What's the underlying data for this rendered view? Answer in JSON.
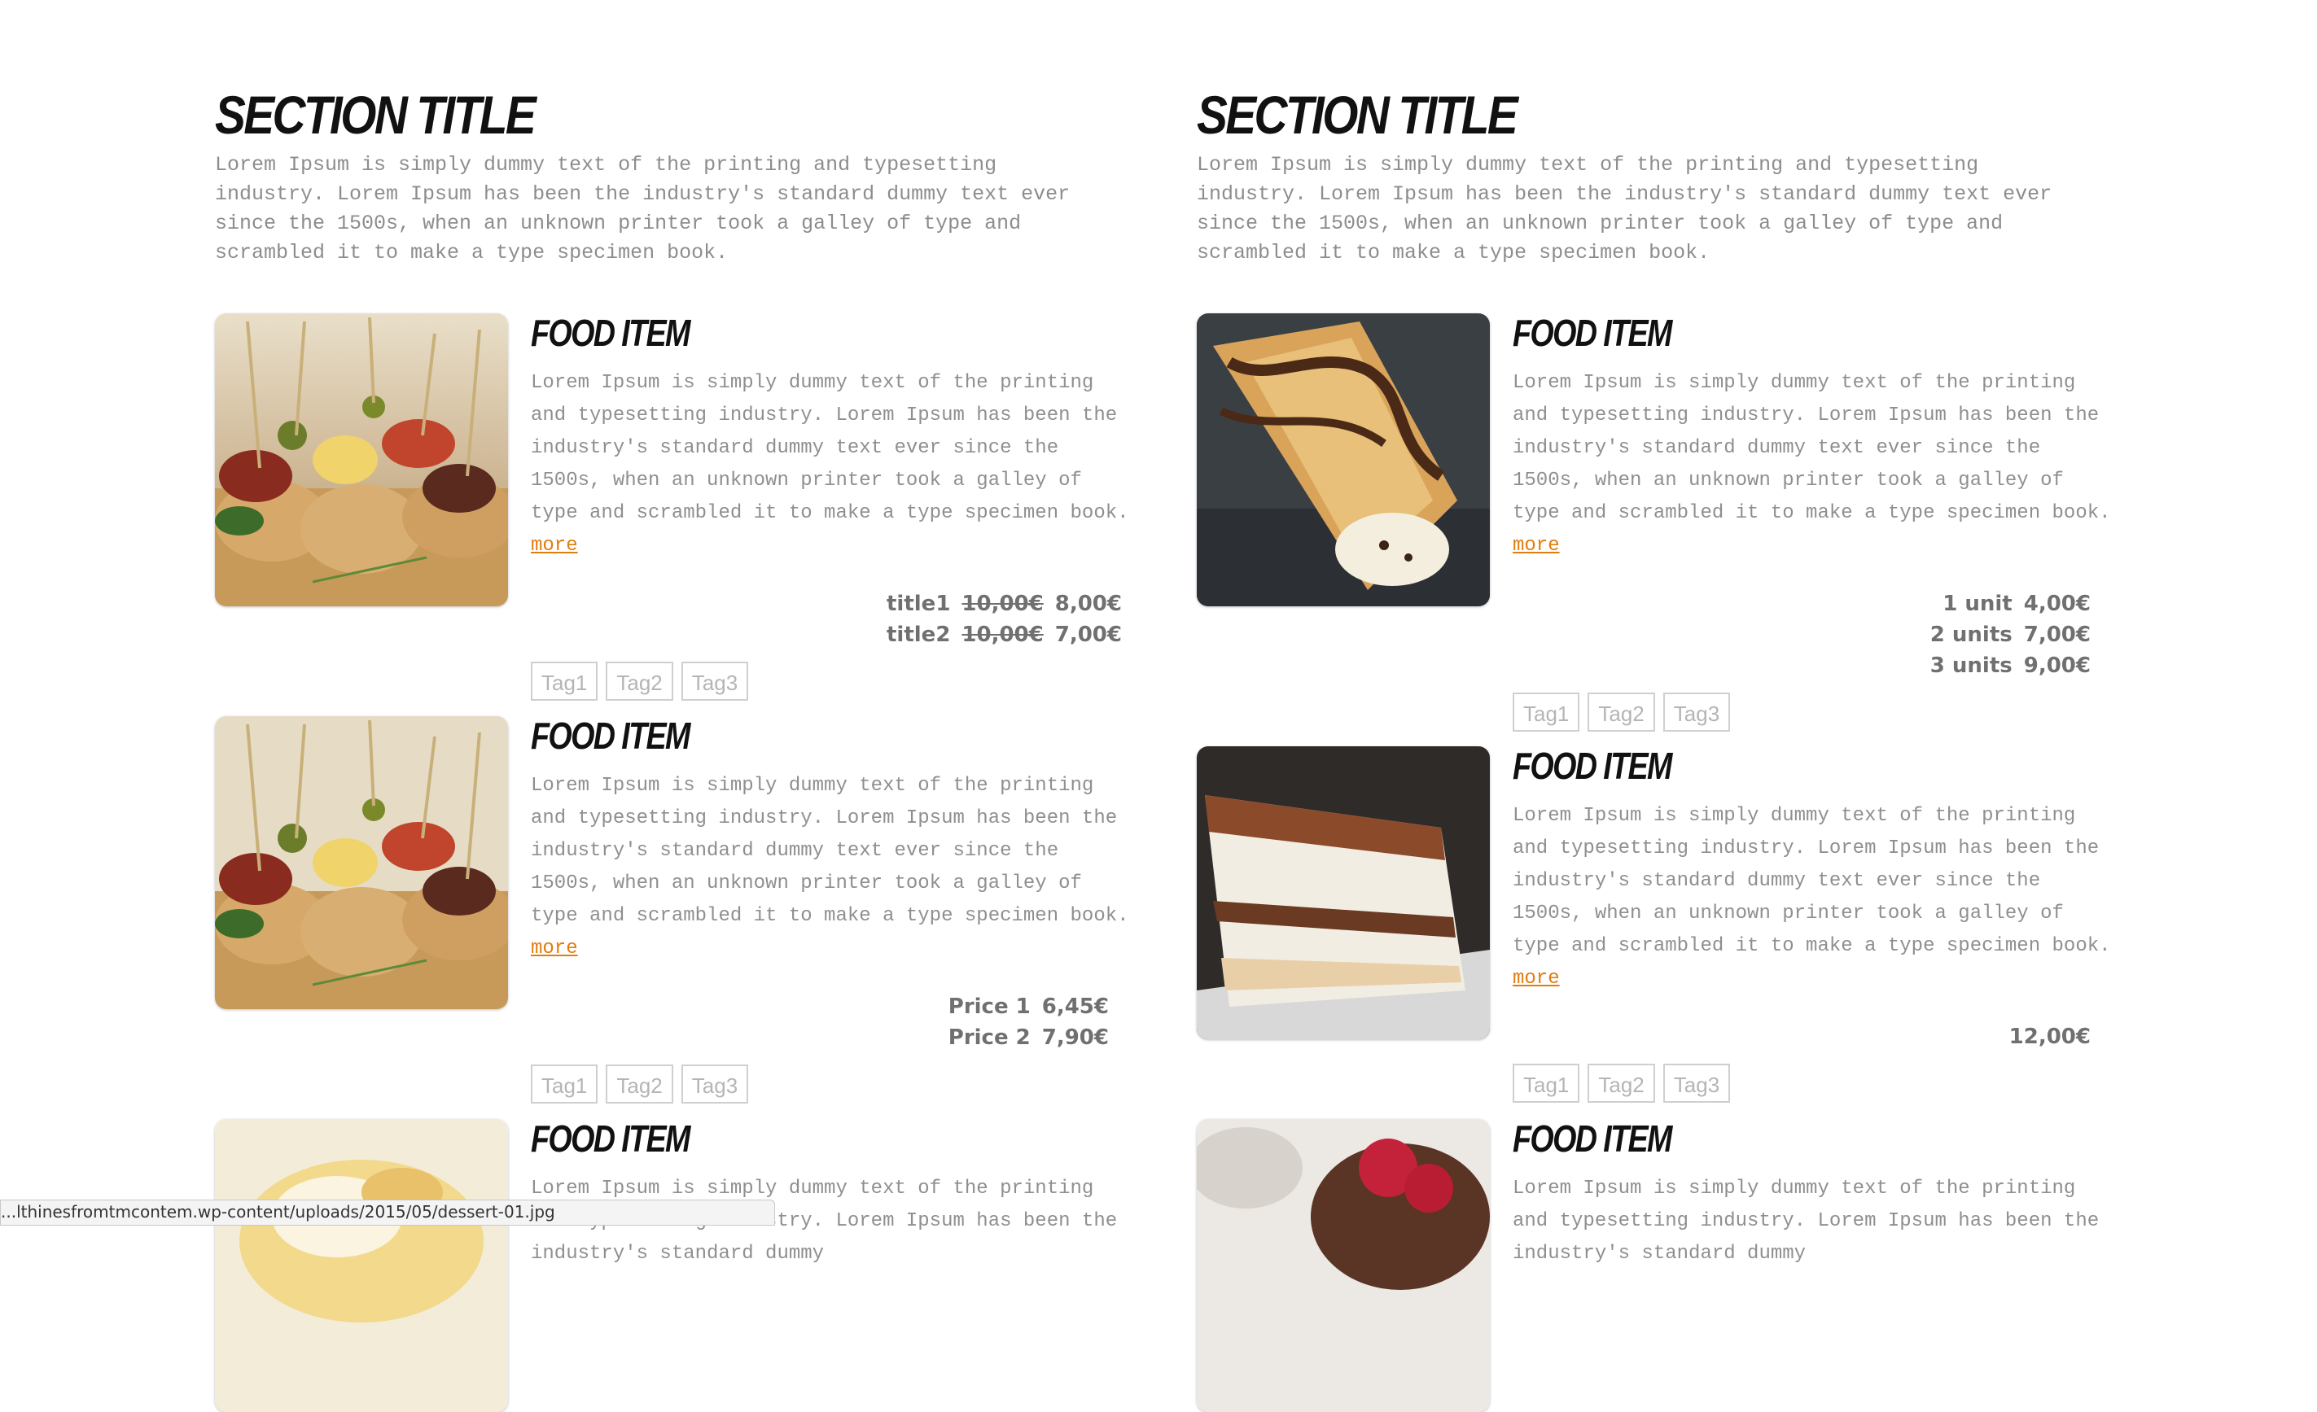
{
  "sections": [
    {
      "title": "SECTION TITLE",
      "description": "Lorem Ipsum is simply dummy text of the printing and typesetting industry. Lorem Ipsum has been the industry's standard dummy text ever since the 1500s, when an unknown printer took a galley of type and scrambled it to make a type specimen book.",
      "items": [
        {
          "title": "FOOD ITEM",
          "description": "Lorem Ipsum is simply dummy text of the printing and typesetting industry. Lorem Ipsum has been the industry's standard dummy text ever since the 1500s, when an unknown printer took a galley of type and scrambled it to make a type specimen book.",
          "more": "more",
          "prices": [
            {
              "label": "title1",
              "old": "10,00€",
              "new": "8,00€"
            },
            {
              "label": "title2",
              "old": "10,00€",
              "new": "7,00€"
            }
          ],
          "tags": [
            "Tag1",
            "Tag2",
            "Tag3"
          ],
          "image": "tapas-skewers-photo"
        },
        {
          "title": "FOOD ITEM",
          "description": "Lorem Ipsum is simply dummy text of the printing and typesetting industry. Lorem Ipsum has been the industry's standard dummy text ever since the 1500s, when an unknown printer took a galley of type and scrambled it to make a type specimen book.",
          "more": "more",
          "prices": [
            {
              "label": "Price 1",
              "new": "6,45€"
            },
            {
              "label": "Price 2",
              "new": "7,90€"
            }
          ],
          "tags": [
            "Tag1",
            "Tag2",
            "Tag3"
          ],
          "image": "tapas-skewers-photo"
        },
        {
          "title": "FOOD ITEM",
          "description": "Lorem Ipsum is simply dummy text of the printing and typesetting industry. Lorem Ipsum has been the industry's standard dummy",
          "image": "pastry-dessert-photo"
        }
      ]
    },
    {
      "title": "SECTION TITLE",
      "description": "Lorem Ipsum is simply dummy text of the printing and typesetting industry. Lorem Ipsum has been the industry's standard dummy text ever since the 1500s, when an unknown printer took a galley of type and scrambled it to make a type specimen book.",
      "items": [
        {
          "title": "FOOD ITEM",
          "description": "Lorem Ipsum is simply dummy text of the printing and typesetting industry. Lorem Ipsum has been the industry's standard dummy text ever since the 1500s, when an unknown printer took a galley of type and scrambled it to make a type specimen book.",
          "more": "more",
          "prices": [
            {
              "label": "1 unit",
              "new": "4,00€"
            },
            {
              "label": "2 units",
              "new": "7,00€"
            },
            {
              "label": "3 units",
              "new": "9,00€"
            }
          ],
          "tags": [
            "Tag1",
            "Tag2",
            "Tag3"
          ],
          "image": "cannoli-photo"
        },
        {
          "title": "FOOD ITEM",
          "description": "Lorem Ipsum is simply dummy text of the printing and typesetting industry. Lorem Ipsum has been the industry's standard dummy text ever since the 1500s, when an unknown printer took a galley of type and scrambled it to make a type specimen book.",
          "more": "more",
          "prices": [
            {
              "label": "",
              "new": "12,00€"
            }
          ],
          "tags": [
            "Tag1",
            "Tag2",
            "Tag3"
          ],
          "image": "tiramisu-cake-photo"
        },
        {
          "title": "FOOD ITEM",
          "description": "Lorem Ipsum is simply dummy text of the printing and typesetting industry. Lorem Ipsum has been the industry's standard dummy",
          "image": "raspberry-dessert-photo"
        }
      ]
    }
  ],
  "status_bar": {
    "url": "...lthinesfromtmcontem.wp-content/uploads/2015/05/dessert-01.jpg"
  },
  "colors": {
    "link": "#e07d10",
    "text_muted": "#8f8f8f",
    "price": "#707070",
    "tag_border": "#cfcfcf"
  }
}
